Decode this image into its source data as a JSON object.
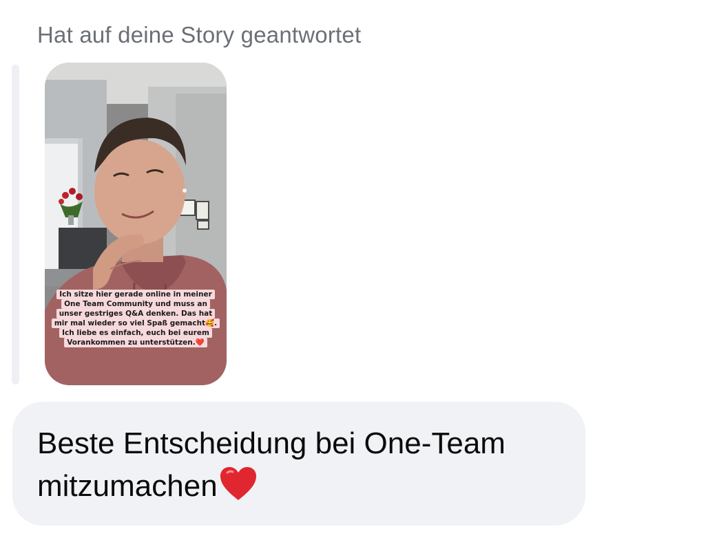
{
  "reply_header": "Hat auf deine Story geantwortet",
  "story": {
    "icon": "story-photo",
    "caption_lines": [
      "Ich sitze hier gerade online in meiner",
      "One Team Community und muss an",
      "unser gestriges Q&A denken. Das hat",
      "mir mal wieder so viel Spaß gemacht🥰.",
      "Ich liebe es einfach, euch bei eurem",
      "Vorankommen zu unterstützen.❤️"
    ]
  },
  "message": {
    "text": "Beste Entscheidung bei One-Team mitzumachen",
    "emoji": "red-heart-icon"
  },
  "colors": {
    "header_text": "#6b6f76",
    "bubble_bg": "#f1f2f5",
    "quote_bar": "#eef0f3",
    "heart": "#e0262f"
  }
}
